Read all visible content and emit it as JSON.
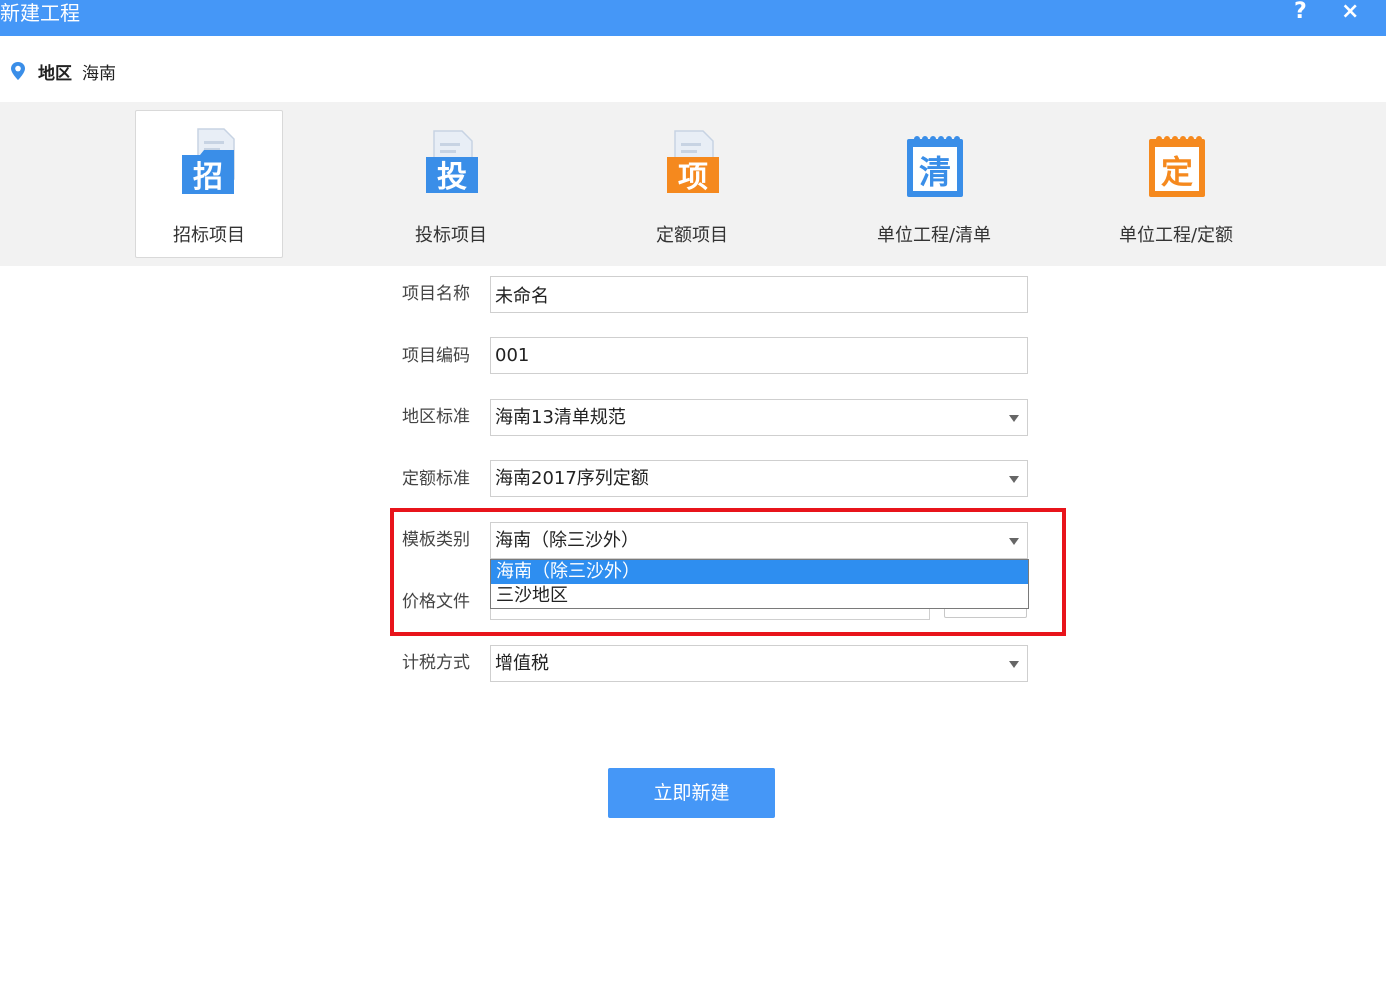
{
  "window": {
    "title": "新建工程",
    "help_label": "?",
    "close_label": "×"
  },
  "region": {
    "label": "地区",
    "value": "海南"
  },
  "project_types": [
    {
      "label": "招标项目",
      "icon_char": "招",
      "icon": "folder-document-icon",
      "color": "#3a8ee8"
    },
    {
      "label": "投标项目",
      "icon_char": "投",
      "icon": "folder-document-icon",
      "color": "#3a8ee8"
    },
    {
      "label": "定额项目",
      "icon_char": "项",
      "icon": "folder-document-icon",
      "color": "#f5891e"
    },
    {
      "label": "单位工程/清单",
      "icon_char": "清",
      "icon": "notepad-icon",
      "color": "#3a8ee8"
    },
    {
      "label": "单位工程/定额",
      "icon_char": "定",
      "icon": "notepad-icon",
      "color": "#f5891e"
    }
  ],
  "form": {
    "project_name": {
      "label": "项目名称",
      "value": "未命名"
    },
    "project_code": {
      "label": "项目编码",
      "value": "001"
    },
    "region_standard": {
      "label": "地区标准",
      "value": "海南13清单规范"
    },
    "quota_standard": {
      "label": "定额标准",
      "value": "海南2017序列定额"
    },
    "template_type": {
      "label": "模板类别",
      "value": "海南（除三沙外）",
      "options": [
        "海南（除三沙外）",
        "三沙地区"
      ]
    },
    "price_file": {
      "label": "价格文件"
    },
    "tax_method": {
      "label": "计税方式",
      "value": "增值税"
    }
  },
  "submit_label": "立即新建",
  "colors": {
    "accent": "#4597f7",
    "highlight": "#e8141b",
    "selected_option": "#2e8ef0",
    "orange": "#f5891e"
  }
}
